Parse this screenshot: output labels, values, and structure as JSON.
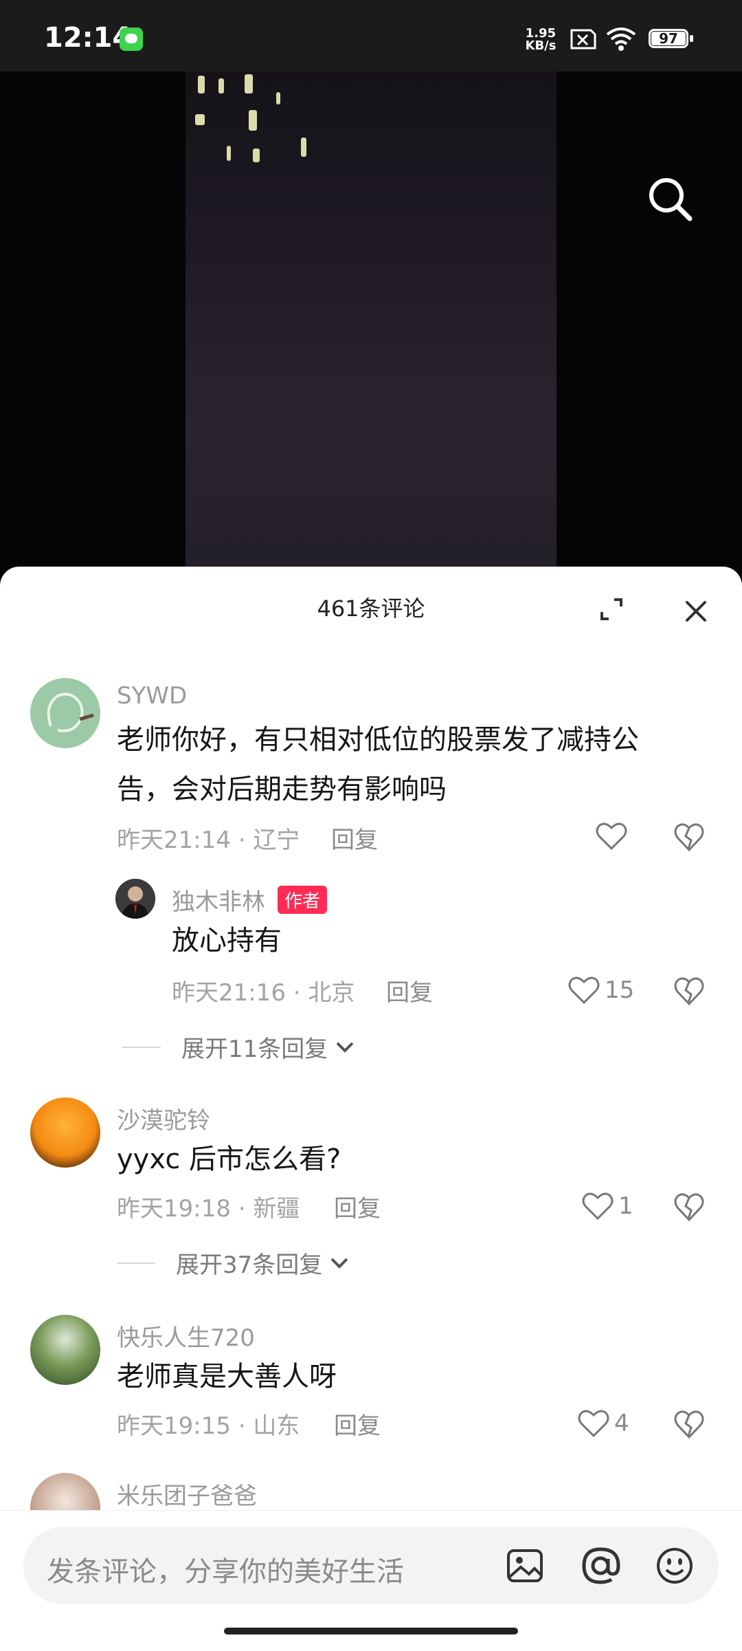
{
  "status_bar": {
    "time": "12:14",
    "net_speed_value": "1.95",
    "net_speed_unit": "KB/s",
    "battery": "97"
  },
  "comments_sheet": {
    "title": "461条评论",
    "comments": [
      {
        "username": "SYWD",
        "text_line1": "老师你好，有只相对低位的股票发了减持公",
        "text_line2": "告，会对后期走势有影响吗",
        "time": "昨天21:14",
        "location": "辽宁",
        "reply_label": "回复",
        "likes": "",
        "sub_reply": {
          "username": "独木非林",
          "badge": "作者",
          "text": "放心持有",
          "time": "昨天21:16",
          "location": "北京",
          "reply_label": "回复",
          "likes": "15"
        },
        "expand_label": "展开11条回复"
      },
      {
        "username": "沙漠驼铃",
        "text": "yyxc 后市怎么看?",
        "time": "昨天19:18",
        "location": "新疆",
        "reply_label": "回复",
        "likes": "1",
        "expand_label": "展开37条回复"
      },
      {
        "username": "快乐人生720",
        "text": "老师真是大善人呀",
        "time": "昨天19:15",
        "location": "山东",
        "reply_label": "回复",
        "likes": "4"
      },
      {
        "username": "米乐团子爸爸"
      }
    ]
  },
  "input": {
    "placeholder": "发条评论，分享你的美好生活"
  },
  "icons": [
    "wechat-icon",
    "sim-x-icon",
    "wifi-icon",
    "battery-icon",
    "search-icon",
    "expand-icon",
    "close-icon",
    "heart-icon",
    "broken-heart-icon",
    "chevron-down-icon",
    "image-icon",
    "at-icon",
    "emoji-icon"
  ],
  "colors": {
    "author_badge": "#fe2c55",
    "sheet_bg": "#ffffff"
  }
}
